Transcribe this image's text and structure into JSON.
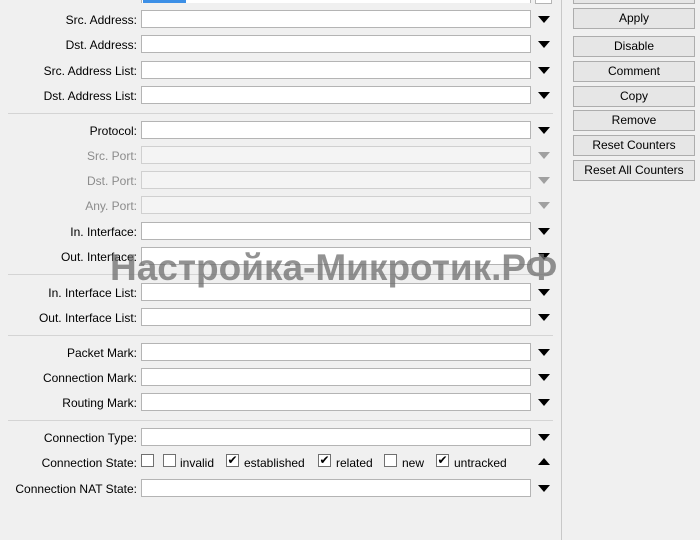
{
  "fields": {
    "src_address": {
      "label": "Src. Address:",
      "value": ""
    },
    "dst_address": {
      "label": "Dst. Address:",
      "value": ""
    },
    "src_address_list": {
      "label": "Src. Address List:",
      "value": ""
    },
    "dst_address_list": {
      "label": "Dst. Address List:",
      "value": ""
    },
    "protocol": {
      "label": "Protocol:",
      "value": ""
    },
    "src_port": {
      "label": "Src. Port:",
      "value": ""
    },
    "dst_port": {
      "label": "Dst. Port:",
      "value": ""
    },
    "any_port": {
      "label": "Any. Port:",
      "value": ""
    },
    "in_interface": {
      "label": "In. Interface:",
      "value": ""
    },
    "out_interface": {
      "label": "Out. Interface:",
      "value": ""
    },
    "in_interface_list": {
      "label": "In. Interface List:",
      "value": ""
    },
    "out_interface_list": {
      "label": "Out. Interface List:",
      "value": ""
    },
    "packet_mark": {
      "label": "Packet Mark:",
      "value": ""
    },
    "connection_mark": {
      "label": "Connection Mark:",
      "value": ""
    },
    "routing_mark": {
      "label": "Routing Mark:",
      "value": ""
    },
    "connection_type": {
      "label": "Connection Type:",
      "value": ""
    },
    "connection_nat_state": {
      "label": "Connection NAT State:",
      "value": ""
    }
  },
  "connection_state": {
    "label": "Connection State:",
    "options": [
      {
        "label": "invalid",
        "checked": false
      },
      {
        "label": "established",
        "checked": true
      },
      {
        "label": "related",
        "checked": true
      },
      {
        "label": "new",
        "checked": false
      },
      {
        "label": "untracked",
        "checked": true
      }
    ],
    "check_glyph": "✔"
  },
  "buttons": {
    "apply": "Apply",
    "disable": "Disable",
    "comment": "Comment",
    "copy": "Copy",
    "remove": "Remove",
    "reset_counters": "Reset Counters",
    "reset_all_counters": "Reset All Counters"
  },
  "watermark": "Настройка-Микротик.РФ",
  "colors": {
    "accent": "#3c8fe6"
  }
}
